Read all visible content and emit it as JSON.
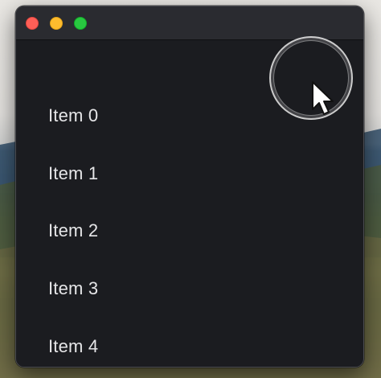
{
  "window": {
    "traffic_lights": {
      "close_color": "#fe5f57",
      "minimize_color": "#febc2e",
      "maximize_color": "#28c840"
    }
  },
  "list": {
    "items": [
      {
        "label": "Item 0"
      },
      {
        "label": "Item 1"
      },
      {
        "label": "Item 2"
      },
      {
        "label": "Item 3"
      },
      {
        "label": "Item 4"
      }
    ]
  },
  "cursor": {
    "icon": "arrow-pointer-icon",
    "highlight": "click-highlight-ring"
  },
  "colors": {
    "window_background": "#1b1c20",
    "titlebar_background": "#2a2b30",
    "item_text": "#e6e6e8"
  }
}
